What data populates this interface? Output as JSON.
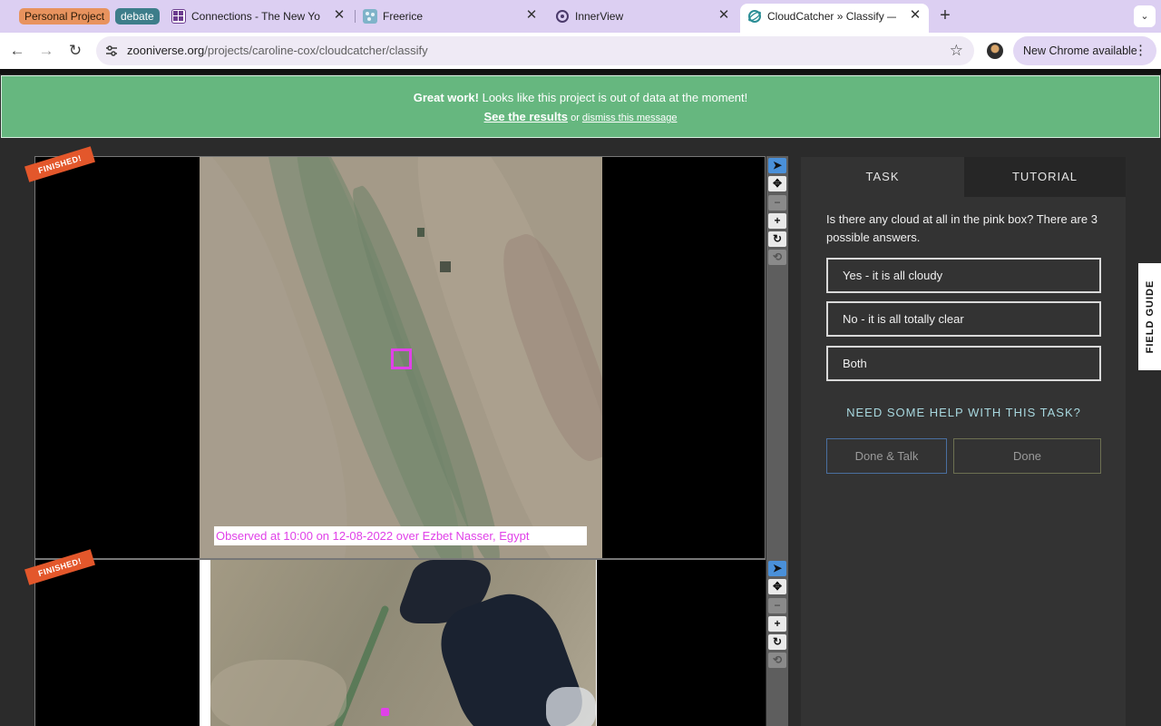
{
  "browser": {
    "tab_groups": [
      {
        "label": "Personal Project",
        "color": "#e8935e"
      },
      {
        "label": "debate",
        "color": "#3d7d8a"
      }
    ],
    "tabs": [
      {
        "title": "Connections - The New York",
        "icon": "nyt-games-icon"
      },
      {
        "title": "Freerice",
        "icon": "freerice-icon"
      },
      {
        "title": "InnerView",
        "icon": "innerview-icon"
      },
      {
        "title": "CloudCatcher » Classify — Zo",
        "icon": "zooniverse-icon",
        "active": true
      }
    ],
    "new_tab": "+",
    "tab_search": "⌄",
    "url_host": "zooniverse.org",
    "url_path": "/projects/caroline-cox/cloudcatcher/classify",
    "new_chrome_label": "New Chrome available"
  },
  "banner": {
    "bold": "Great work!",
    "text": " Looks like this project is out of data at the moment!",
    "results_link": "See the results",
    "or": " or ",
    "dismiss_link": "dismiss this message",
    "color": "#66b77f"
  },
  "subjects": [
    {
      "ribbon": "FINISHED!",
      "caption": "Observed at 10:00 on 12-08-2022 over Ezbet Nasser, Egypt"
    },
    {
      "ribbon": "FINISHED!"
    }
  ],
  "tools": [
    "pointer-icon",
    "pan-icon",
    "zoom-out-icon",
    "zoom-in-icon",
    "rotate-icon",
    "reset-icon"
  ],
  "panel": {
    "tab_task": "TASK",
    "tab_tutorial": "TUTORIAL",
    "question": "Is there any cloud at all in the pink box? There are 3 possible answers.",
    "answers": [
      "Yes - it is all cloudy",
      "No - it is all totally clear",
      "Both"
    ],
    "help": "NEED SOME HELP WITH THIS TASK?",
    "done_talk": "Done & Talk",
    "done": "Done"
  },
  "field_guide": "FIELD GUIDE"
}
